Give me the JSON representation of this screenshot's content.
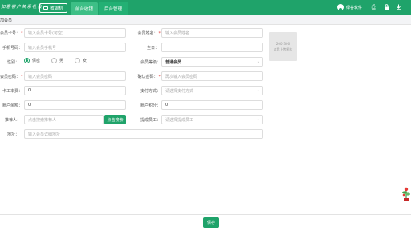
{
  "header": {
    "brand": "如意客户关系社会",
    "cashier_label": "收银机",
    "tabs": [
      {
        "label": "前台收银",
        "active": true
      },
      {
        "label": "后台管理",
        "active": false
      }
    ],
    "store_name": "绿谷软件"
  },
  "page": {
    "subtitle": "加会员"
  },
  "form": {
    "card_no": {
      "label": "会员卡号：",
      "placeholder": "输入会员卡号(可空)"
    },
    "name": {
      "label": "会员姓名：",
      "placeholder": "输入会员姓名"
    },
    "phone": {
      "label": "手机号码：",
      "placeholder": "输入会员手机号"
    },
    "birthday": {
      "label": "生日：",
      "value": ""
    },
    "gender": {
      "label": "性别：",
      "options": [
        "保密",
        "男",
        "女"
      ],
      "selected": "保密"
    },
    "level": {
      "label": "会员等级：",
      "value": "普通会员"
    },
    "password": {
      "label": "会员密码：",
      "placeholder": "输入会员密码"
    },
    "confirm_password": {
      "label": "确认密码：",
      "placeholder": "再次输入会员密码"
    },
    "card_fee": {
      "label": "卡工本费：",
      "value": "0"
    },
    "payment": {
      "label": "支付方式：",
      "placeholder": "请选择支付方式"
    },
    "balance": {
      "label": "账户余额：",
      "value": "0"
    },
    "points": {
      "label": "账户积分：",
      "value": "0"
    },
    "referrer": {
      "label": "推荐人：",
      "placeholder": "点击搜索推荐人",
      "button": "点击搜索"
    },
    "staff": {
      "label": "提成员工：",
      "placeholder": "请选择提成员工"
    },
    "address": {
      "label": "地址：",
      "placeholder": "输入会员详细地址"
    },
    "photo": {
      "size": "200*300",
      "hint": "点我上传图片"
    }
  },
  "footer": {
    "save_label": "保存"
  },
  "colors": {
    "primary": "#1fa36a",
    "required": "#e53935"
  }
}
